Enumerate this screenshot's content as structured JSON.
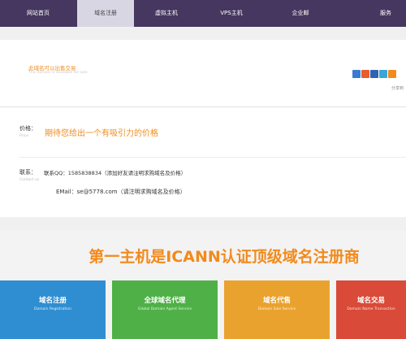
{
  "nav": {
    "items": [
      "网站首页",
      "域名注册",
      "虚拟主机",
      "VPS主机",
      "企业邮",
      "服务"
    ]
  },
  "promo": {
    "title": "此域名可以出售交易",
    "subtitle": "This domain is available for sale."
  },
  "share": {
    "label": "分享到",
    "icons": [
      "qzone-icon",
      "weibo-icon",
      "renren-icon",
      "tencent-weibo-icon",
      "more-share-icon"
    ],
    "colors": [
      "#3b7ad2",
      "#e85d2a",
      "#2e62b4",
      "#39a6d8",
      "#f08c1e"
    ]
  },
  "price": {
    "label": "价格：",
    "label_en": "Price",
    "value": "期待您给出一个有吸引力的价格"
  },
  "contact": {
    "label": "联系：",
    "label_en": "Contact us",
    "qq": "联系QQ：1585838834（添加好友请注明求购域名及价格）",
    "email": "EMail：se@5778.com（请注明求购域名及价格）"
  },
  "banner": {
    "title": "第一主机是ICANN认证顶级域名注册商"
  },
  "tiles": [
    {
      "title": "域名注册",
      "subtitle": "Domain Registration",
      "color": "#2f8ed1"
    },
    {
      "title": "全球域名代理",
      "subtitle": "Global Domain Agent Service",
      "color": "#4fb047"
    },
    {
      "title": "域名代售",
      "subtitle": "Domain Sale Service",
      "color": "#eaa22e"
    },
    {
      "title": "域名交易",
      "subtitle": "Domain Name Transaction",
      "color": "#d94a38"
    }
  ]
}
